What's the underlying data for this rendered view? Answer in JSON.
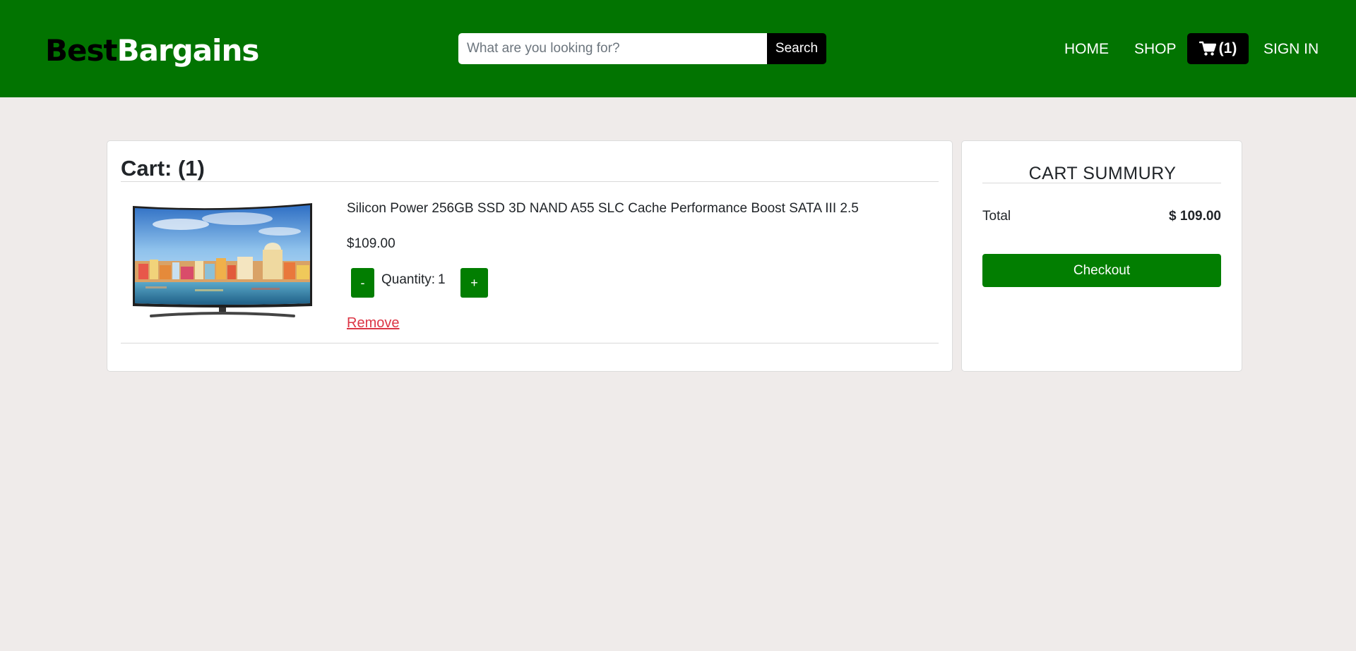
{
  "header": {
    "logo_part1": "Best",
    "logo_part2": "Bargains",
    "search": {
      "placeholder": "What are you looking for?",
      "value": "",
      "button_label": "Search"
    },
    "nav": {
      "home": "HOME",
      "shop": "SHOP",
      "cart_count": "(1)",
      "sign_in": "SIGN IN"
    },
    "icons": {
      "cart": "shopping-cart-icon"
    }
  },
  "cart": {
    "title": "Cart: (1)",
    "items": [
      {
        "name": "Silicon Power 256GB SSD 3D NAND A55 SLC Cache Performance Boost SATA III 2.5",
        "price": "$109.00",
        "quantity_label": "Quantity:",
        "quantity": "1",
        "decrement_label": "-",
        "increment_label": "+",
        "remove_label": "Remove",
        "image": "curved-tv-image"
      }
    ]
  },
  "summary": {
    "title": "CART SUMMURY",
    "total_label": "Total",
    "total_value": "$ 109.00",
    "checkout_label": "Checkout"
  },
  "colors": {
    "header_bg": "#027401",
    "page_bg": "#efebea",
    "accent_green": "#027e01",
    "remove_red": "#dc3545",
    "black": "#000000"
  }
}
